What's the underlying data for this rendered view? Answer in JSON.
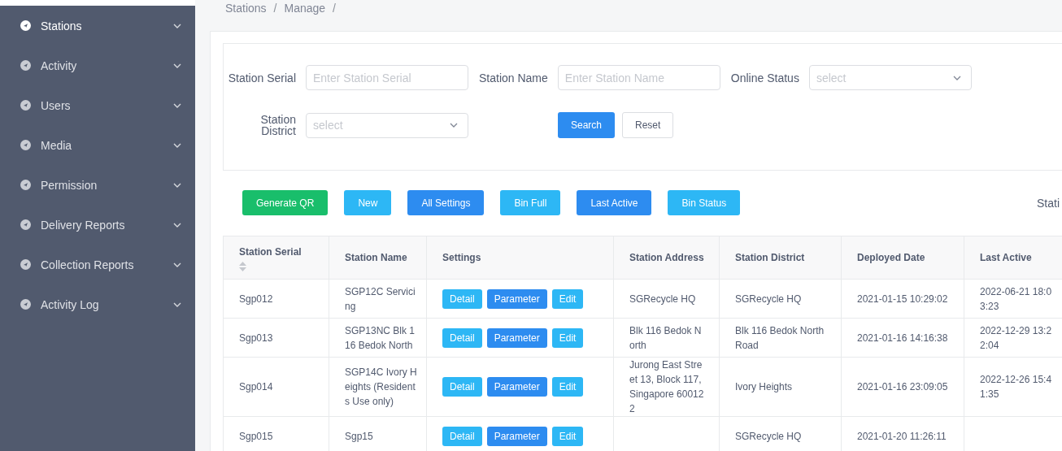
{
  "sidebar": {
    "items": [
      {
        "label": "Stations",
        "selected": true
      },
      {
        "label": "Activity",
        "selected": false
      },
      {
        "label": "Users",
        "selected": false
      },
      {
        "label": "Media",
        "selected": false
      },
      {
        "label": "Permission",
        "selected": false
      },
      {
        "label": "Delivery Reports",
        "selected": false
      },
      {
        "label": "Collection Reports",
        "selected": false
      },
      {
        "label": "Activity Log",
        "selected": false
      }
    ]
  },
  "breadcrumb": {
    "items": [
      "Stations",
      "Manage"
    ],
    "separator": "/"
  },
  "filters": [
    {
      "kind": "input",
      "label": "Station Serial",
      "placeholder": "Enter Station Serial"
    },
    {
      "kind": "input",
      "label": "Station Name",
      "placeholder": "Enter Station Name"
    },
    {
      "kind": "select",
      "label": "Online Status",
      "placeholder": "select"
    },
    {
      "kind": "select",
      "label": "Station District",
      "placeholder": "select"
    }
  ],
  "filter_buttons": [
    {
      "label": "Search",
      "kind": "primary"
    },
    {
      "label": "Reset",
      "kind": "default"
    }
  ],
  "actions": [
    {
      "label": "Generate QR",
      "kind": "success"
    },
    {
      "label": "New",
      "kind": "info"
    },
    {
      "label": "All Settings",
      "kind": "primary"
    },
    {
      "label": "Bin Full",
      "kind": "info"
    },
    {
      "label": "Last Active",
      "kind": "primary"
    },
    {
      "label": "Bin Status",
      "kind": "info"
    }
  ],
  "actions_trailing_text": "Stati",
  "table": {
    "columns": [
      {
        "label": "Station Serial",
        "sortable": true
      },
      {
        "label": "Station Name",
        "sortable": false
      },
      {
        "label": "Settings",
        "sortable": false
      },
      {
        "label": "Station Address",
        "sortable": false
      },
      {
        "label": "Station District",
        "sortable": false
      },
      {
        "label": "Deployed Date",
        "sortable": false
      },
      {
        "label": "Last Active",
        "sortable": false
      }
    ],
    "rows": [
      {
        "serial": "Sgp012",
        "name": "SGP12C Servicing",
        "buttons": [
          {
            "label": "Detail",
            "kind": "info"
          },
          {
            "label": "Parameter",
            "kind": "primary"
          },
          {
            "label": "Edit",
            "kind": "info"
          }
        ],
        "address": "SGRecycle HQ",
        "district": "SGRecycle HQ",
        "deployed": "2021-01-15 10:29:02",
        "last_active": "2022-06-21 18:03:23"
      },
      {
        "serial": "Sgp013",
        "name": "SGP13NC Blk 116 Bedok North",
        "buttons": [
          {
            "label": "Detail",
            "kind": "info"
          },
          {
            "label": "Parameter",
            "kind": "primary"
          },
          {
            "label": "Edit",
            "kind": "info"
          }
        ],
        "address": "Blk 116 Bedok North",
        "district": "Blk 116 Bedok North Road",
        "deployed": "2021-01-16 14:16:38",
        "last_active": "2022-12-29 13:22:04"
      },
      {
        "serial": "Sgp014",
        "name": "SGP14C Ivory Heights (Residents Use only)",
        "buttons": [
          {
            "label": "Detail",
            "kind": "info"
          },
          {
            "label": "Parameter",
            "kind": "primary"
          },
          {
            "label": "Edit",
            "kind": "info"
          }
        ],
        "address": "Jurong East Street 13, Block 117, Singapore 600122",
        "district": "Ivory Heights",
        "deployed": "2021-01-16 23:09:05",
        "last_active": "2022-12-26 15:41:35"
      },
      {
        "serial": "Sgp015",
        "name": "Sgp15",
        "buttons": [
          {
            "label": "Detail",
            "kind": "info"
          },
          {
            "label": "Parameter",
            "kind": "primary"
          },
          {
            "label": "Edit",
            "kind": "info"
          }
        ],
        "address": "",
        "district": "SGRecycle HQ",
        "deployed": "2021-01-20 11:26:11",
        "last_active": ""
      }
    ]
  }
}
